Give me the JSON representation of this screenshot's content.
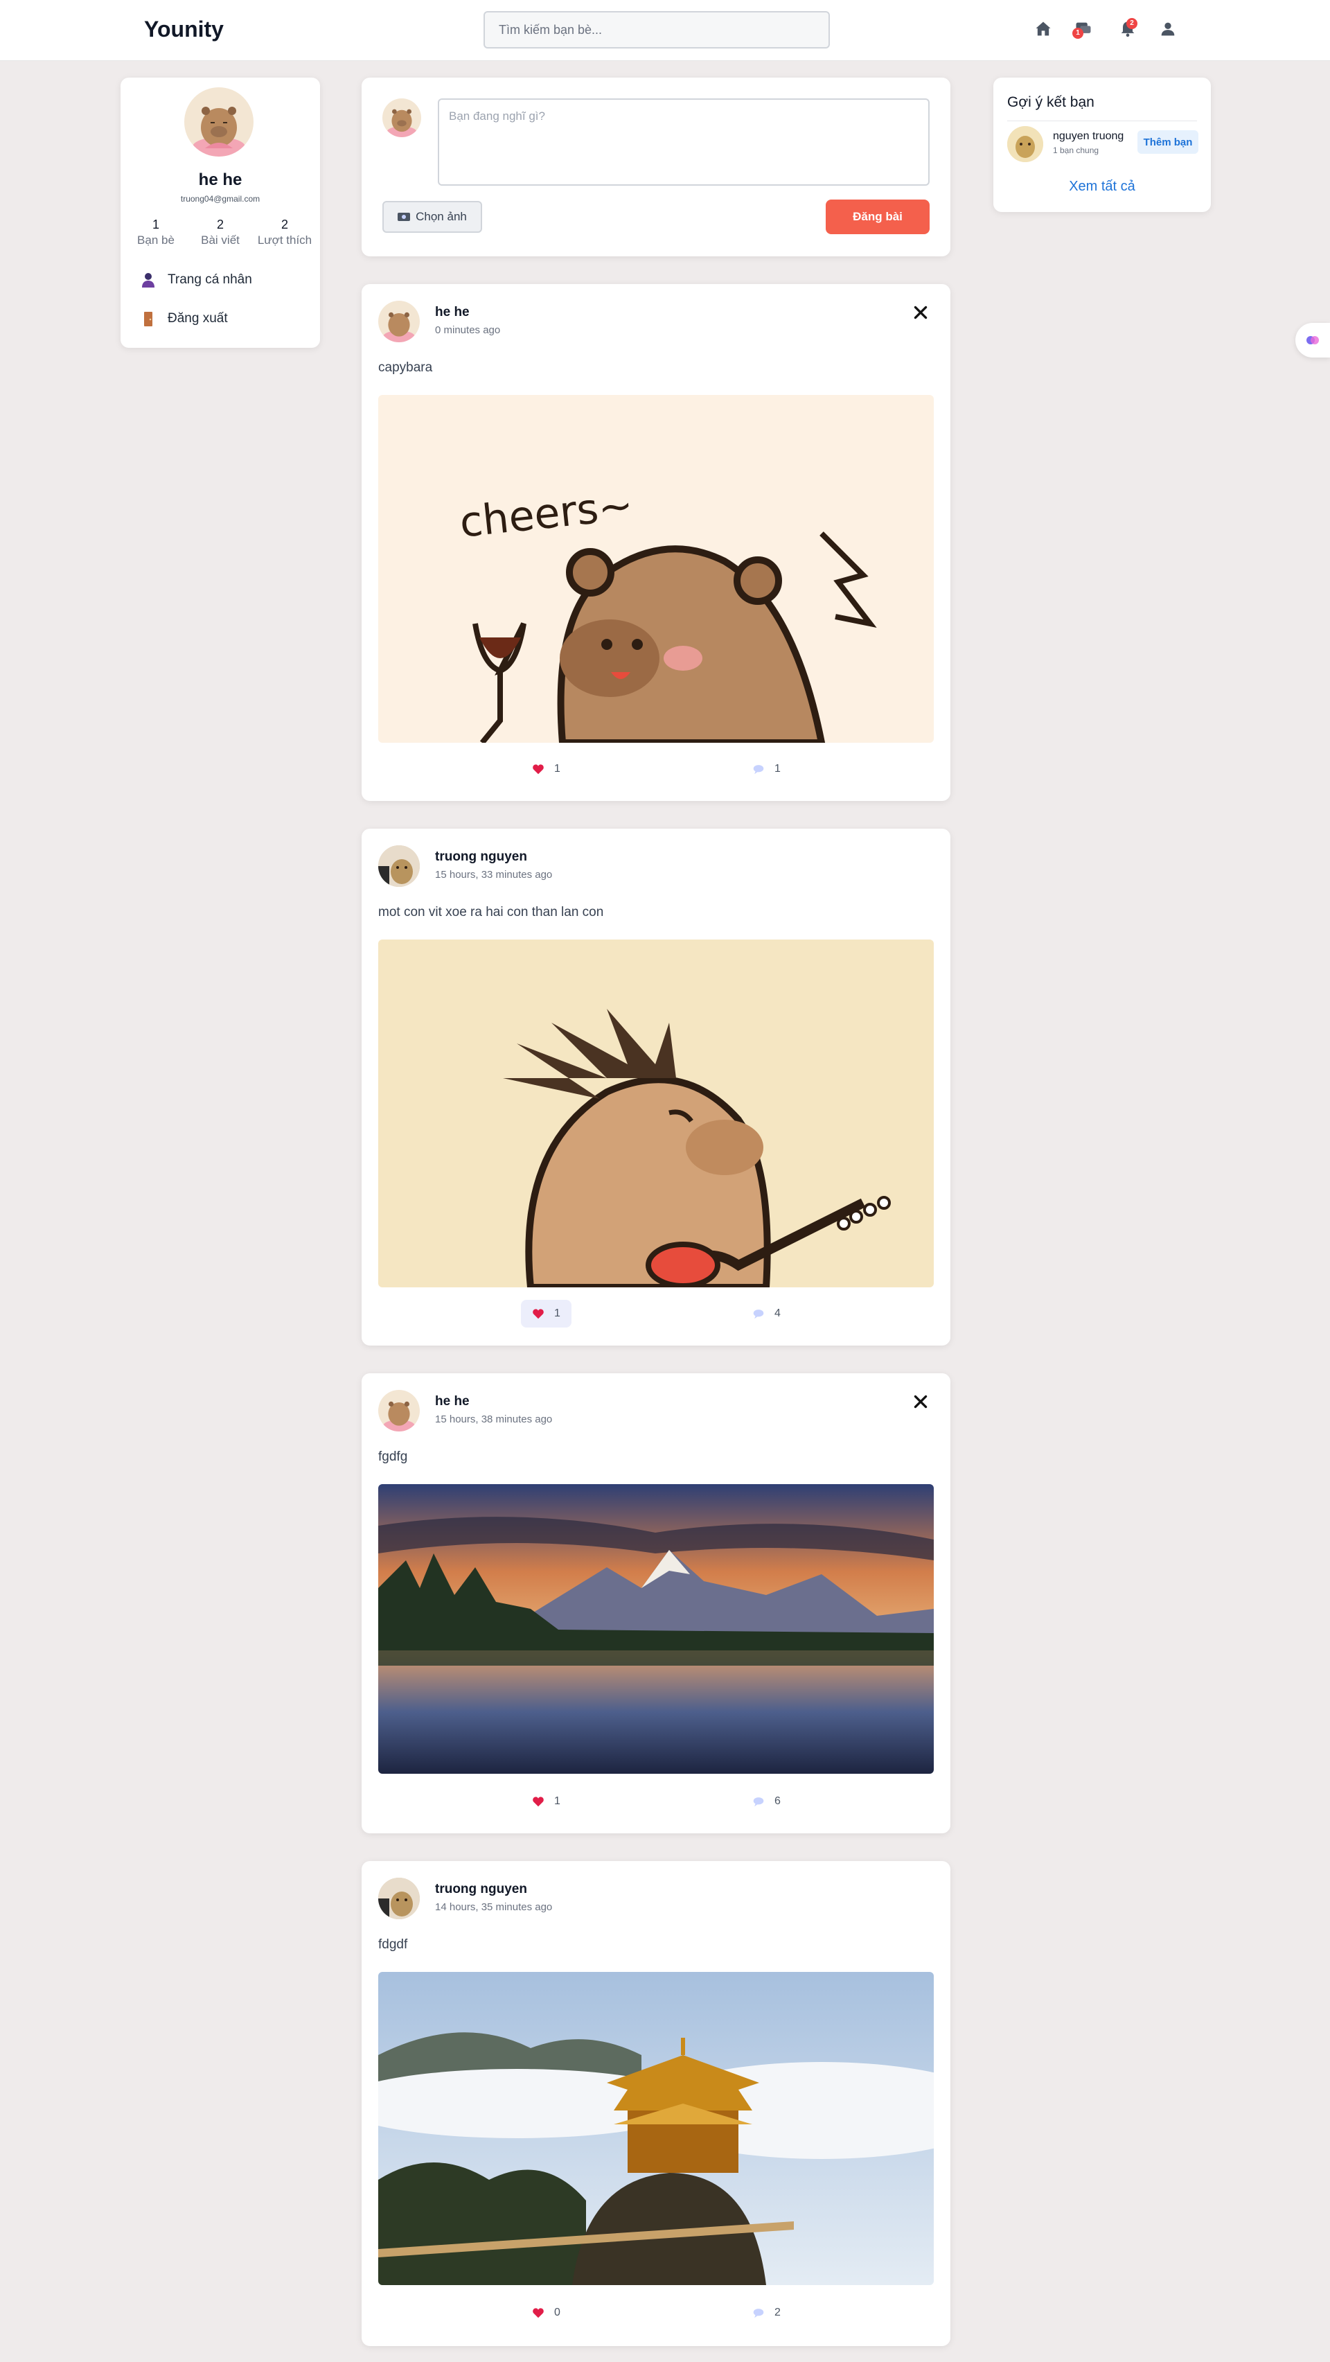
{
  "header": {
    "logo": "Younity",
    "search_placeholder": "Tìm kiếm bạn bè...",
    "messages_badge": "1",
    "notifications_badge": "2"
  },
  "profile": {
    "name": "he he",
    "email": "truong04@gmail.com",
    "stats": [
      {
        "value": "1",
        "label": "Bạn bè"
      },
      {
        "value": "2",
        "label": "Bài viết"
      },
      {
        "value": "2",
        "label": "Lượt thích"
      }
    ],
    "menu": [
      {
        "icon": "user-icon",
        "label": "Trang cá nhân"
      },
      {
        "icon": "logout-door-icon",
        "label": "Đăng xuất"
      }
    ]
  },
  "composer": {
    "placeholder": "Bạn đang nghĩ gì?",
    "choose_image": "Chọn ảnh",
    "post_button": "Đăng bài"
  },
  "suggestions": {
    "title": "Gợi ý kết bạn",
    "items": [
      {
        "name": "nguyen truong",
        "mutual": "1 bạn chung",
        "add_label": "Thêm bạn"
      }
    ],
    "see_all": "Xem tất cả"
  },
  "posts": [
    {
      "author": "he he",
      "time": "0 minutes ago",
      "text": "capybara",
      "likes": "1",
      "comments": "1",
      "liked": false,
      "deletable": true,
      "image": "capybara cheers sticker"
    },
    {
      "author": "truong nguyen",
      "time": "15 hours, 33 minutes ago",
      "text": "mot con vit xoe ra hai con than lan con",
      "likes": "1",
      "comments": "4",
      "liked": true,
      "deletable": false,
      "image": "capybara playing guitar sticker"
    },
    {
      "author": "he he",
      "time": "15 hours, 38 minutes ago",
      "text": "fgdfg",
      "likes": "1",
      "comments": "6",
      "liked": false,
      "deletable": true,
      "image": "mountain lake at sunset"
    },
    {
      "author": "truong nguyen",
      "time": "14 hours, 35 minutes ago",
      "text": "fdgdf",
      "likes": "0",
      "comments": "2",
      "liked": false,
      "deletable": false,
      "image": "golden temple above clouds"
    }
  ],
  "colors": {
    "accent": "#f4604c",
    "link": "#1e73d8",
    "badge": "#ef4444",
    "background": "#efebeb"
  }
}
